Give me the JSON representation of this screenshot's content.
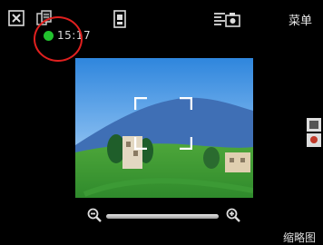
{
  "status": {
    "time": "15:17"
  },
  "toolbar": {
    "menu_label": "菜单"
  },
  "gallery": {
    "thumbnail_label": "缩略图"
  },
  "zoom": {
    "level": 0.1
  },
  "icons": {
    "close": "close-icon",
    "copy": "copy-icon",
    "mode": "camera-mode-icon",
    "settings": "settings-icon",
    "zoom_out": "zoom-out-icon",
    "zoom_in": "zoom-in-icon",
    "capture_mode": "capture-mode-icon"
  },
  "colors": {
    "status_dot": "#22c22e",
    "highlight": "#e0201f",
    "background": "#000000"
  }
}
